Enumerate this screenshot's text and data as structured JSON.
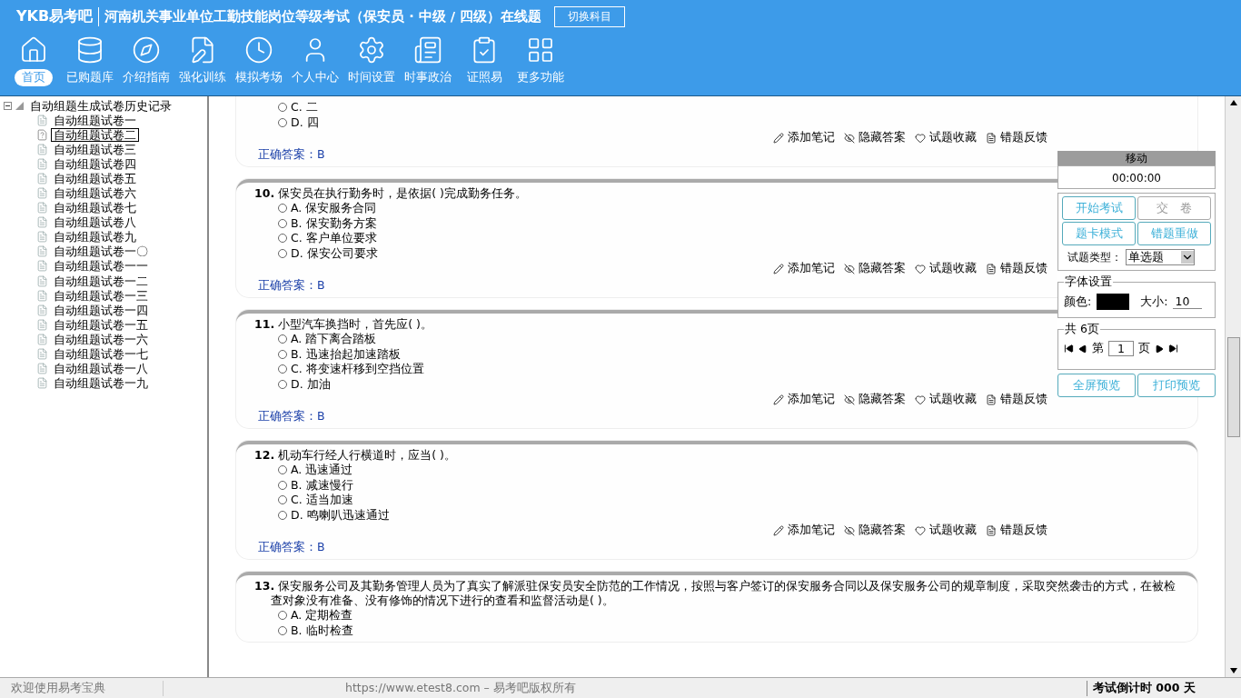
{
  "header": {
    "logo": "YKB易考吧",
    "title": "河南机关事业单位工勤技能岗位等级考试（保安员 · 中级 / 四级）在线题",
    "switch_button": "切换科目"
  },
  "toolbar": [
    {
      "label": "首页",
      "selected": true
    },
    {
      "label": "已购题库",
      "selected": false
    },
    {
      "label": "介绍指南",
      "selected": false
    },
    {
      "label": "强化训练",
      "selected": false
    },
    {
      "label": "模拟考场",
      "selected": false
    },
    {
      "label": "个人中心",
      "selected": false
    },
    {
      "label": "时间设置",
      "selected": false
    },
    {
      "label": "时事政治",
      "selected": false
    },
    {
      "label": "证照易",
      "selected": false
    },
    {
      "label": "更多功能",
      "selected": false
    }
  ],
  "tree": {
    "label": "自动组题生成试卷历史记录",
    "expanded": true,
    "children": [
      {
        "label": "自动组题试卷一",
        "selected": false
      },
      {
        "label": "自动组题试卷二",
        "selected": true
      },
      {
        "label": "自动组题试卷三",
        "selected": false
      },
      {
        "label": "自动组题试卷四",
        "selected": false
      },
      {
        "label": "自动组题试卷五",
        "selected": false
      },
      {
        "label": "自动组题试卷六",
        "selected": false
      },
      {
        "label": "自动组题试卷七",
        "selected": false
      },
      {
        "label": "自动组题试卷八",
        "selected": false
      },
      {
        "label": "自动组题试卷九",
        "selected": false
      },
      {
        "label": "自动组题试卷一〇",
        "selected": false
      },
      {
        "label": "自动组题试卷一一",
        "selected": false
      },
      {
        "label": "自动组题试卷一二",
        "selected": false
      },
      {
        "label": "自动组题试卷一三",
        "selected": false
      },
      {
        "label": "自动组题试卷一四",
        "selected": false
      },
      {
        "label": "自动组题试卷一五",
        "selected": false
      },
      {
        "label": "自动组题试卷一六",
        "selected": false
      },
      {
        "label": "自动组题试卷一七",
        "selected": false
      },
      {
        "label": "自动组题试卷一八",
        "selected": false
      },
      {
        "label": "自动组题试卷一九",
        "selected": false
      }
    ]
  },
  "questions": [
    {
      "options": [
        {
          "label": "C. 二",
          "selected": false
        },
        {
          "label": "D. 四",
          "selected": false
        }
      ],
      "actions": [
        "添加笔记",
        "隐藏答案",
        "试题收藏",
        "错题反馈"
      ],
      "answer": "正确答案：B"
    },
    {
      "number": "10.",
      "text": "保安员在执行勤务时，是依据( )完成勤务任务。",
      "options": [
        {
          "label": "A. 保安服务合同",
          "selected": false
        },
        {
          "label": "B. 保安勤务方案",
          "selected": false
        },
        {
          "label": "C. 客户单位要求",
          "selected": false
        },
        {
          "label": "D. 保安公司要求",
          "selected": false
        }
      ],
      "actions": [
        "添加笔记",
        "隐藏答案",
        "试题收藏",
        "错题反馈"
      ],
      "answer": "正确答案：B"
    },
    {
      "number": "11.",
      "text": "小型汽车换挡时，首先应( )。",
      "options": [
        {
          "label": "A. 踏下离合踏板",
          "selected": false
        },
        {
          "label": "B. 迅速抬起加速踏板",
          "selected": false
        },
        {
          "label": "C. 将变速杆移到空挡位置",
          "selected": false
        },
        {
          "label": "D. 加油",
          "selected": false
        }
      ],
      "actions": [
        "添加笔记",
        "隐藏答案",
        "试题收藏",
        "错题反馈"
      ],
      "answer": "正确答案：B"
    },
    {
      "number": "12.",
      "text": "机动车行经人行横道时，应当( )。",
      "options": [
        {
          "label": "A. 迅速通过",
          "selected": false
        },
        {
          "label": "B. 减速慢行",
          "selected": false
        },
        {
          "label": "C. 适当加速",
          "selected": false
        },
        {
          "label": "D. 鸣喇叭迅速通过",
          "selected": false
        }
      ],
      "actions": [
        "添加笔记",
        "隐藏答案",
        "试题收藏",
        "错题反馈"
      ],
      "answer": "正确答案：B"
    },
    {
      "number": "13.",
      "text": "保安服务公司及其勤务管理人员为了真实了解派驻保安员安全防范的工作情况，按照与客户签订的保安服务合同以及保安服务公司的规章制度，采取突然袭击的方式，在被检查对象没有准备、没有修饰的情况下进行的查看和监督活动是( )。",
      "options": [
        {
          "label": "A. 定期检查",
          "selected": false
        },
        {
          "label": "B. 临时检查",
          "selected": false
        }
      ]
    }
  ],
  "panel": {
    "title": "移动",
    "timer": "00:00:00",
    "buttons": [
      {
        "label": "开始考试",
        "disabled": false
      },
      {
        "label": "交　卷",
        "disabled": true
      },
      {
        "label": "题卡模式",
        "disabled": false
      },
      {
        "label": "错题重做",
        "disabled": false
      }
    ],
    "type_label": "试题类型：",
    "type_value": "单选题",
    "font_group": "字体设置",
    "color_label": "颜色:",
    "size_label": "大小:",
    "size_value": "10",
    "page_group": "共 6页",
    "page_prefix": "第",
    "page_value": "1",
    "page_suffix": "页",
    "bottom_buttons": [
      "全屏预览",
      "打印预览"
    ]
  },
  "status_bar": {
    "welcome": "欢迎使用易考宝典",
    "copyright": "https://www.etest8.com – 易考吧版权所有",
    "countdown": "考试倒计时 000 天"
  }
}
